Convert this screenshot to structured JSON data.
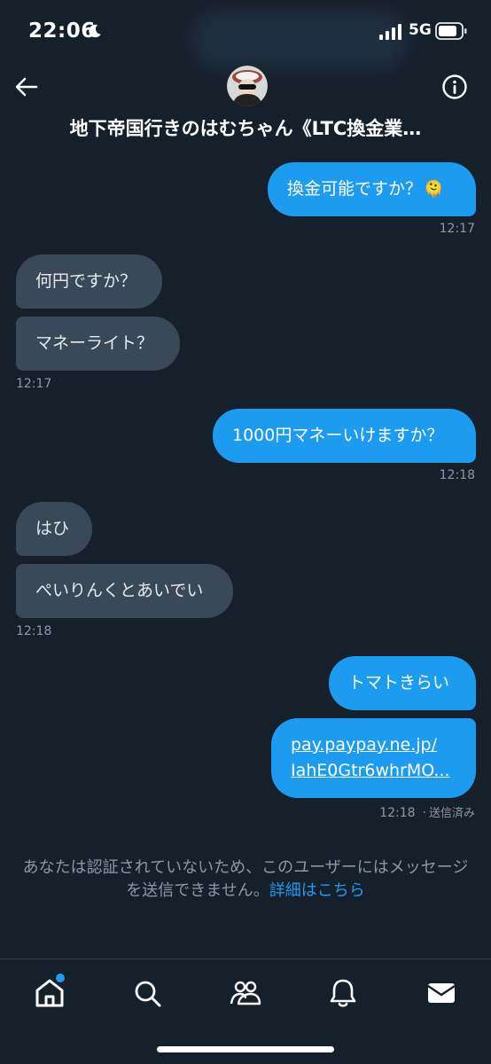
{
  "status_bar": {
    "time": "22:06",
    "network": "5G"
  },
  "header": {
    "title": "地下帝国行きのはむちゃん《LTC換金業…"
  },
  "messages": [
    {
      "direction": "out",
      "text": "換金可能ですか？",
      "emoji": "🫠"
    },
    {
      "direction": "out_time",
      "time": "12:17"
    },
    {
      "direction": "in",
      "text": "何円ですか？"
    },
    {
      "direction": "in",
      "text": "マネーライト？"
    },
    {
      "direction": "in_time",
      "time": "12:17"
    },
    {
      "direction": "out",
      "text": "1000円マネーいけますか？"
    },
    {
      "direction": "out_time",
      "time": "12:18"
    },
    {
      "direction": "in",
      "text": "はひ"
    },
    {
      "direction": "in",
      "text": "ぺいりんくとあいでい"
    },
    {
      "direction": "in_time",
      "time": "12:18"
    },
    {
      "direction": "out",
      "text": "トマトきらい"
    },
    {
      "direction": "out_link",
      "line1": "pay.paypay.ne.jp/",
      "line2": "IahE0Gtr6whrMO..."
    },
    {
      "direction": "out_time",
      "time": "12:18",
      "status": "送信済み"
    }
  ],
  "notice": {
    "text": "あなたは認証されていないため、このユーザーにはメッセージを送信できません。",
    "link": "詳細はこちら"
  },
  "bottom_nav": {
    "items": [
      {
        "icon": "home-icon",
        "active": true,
        "has_notification_dot": true
      },
      {
        "icon": "search-icon"
      },
      {
        "icon": "communities-icon"
      },
      {
        "icon": "bell-icon"
      },
      {
        "icon": "mail-icon"
      }
    ]
  },
  "colors": {
    "background": "#16202b",
    "outgoing_bubble": "#1d9bf0",
    "incoming_bubble": "#3a4958",
    "muted_text": "#8b98a5",
    "accent": "#1d9bf0"
  }
}
